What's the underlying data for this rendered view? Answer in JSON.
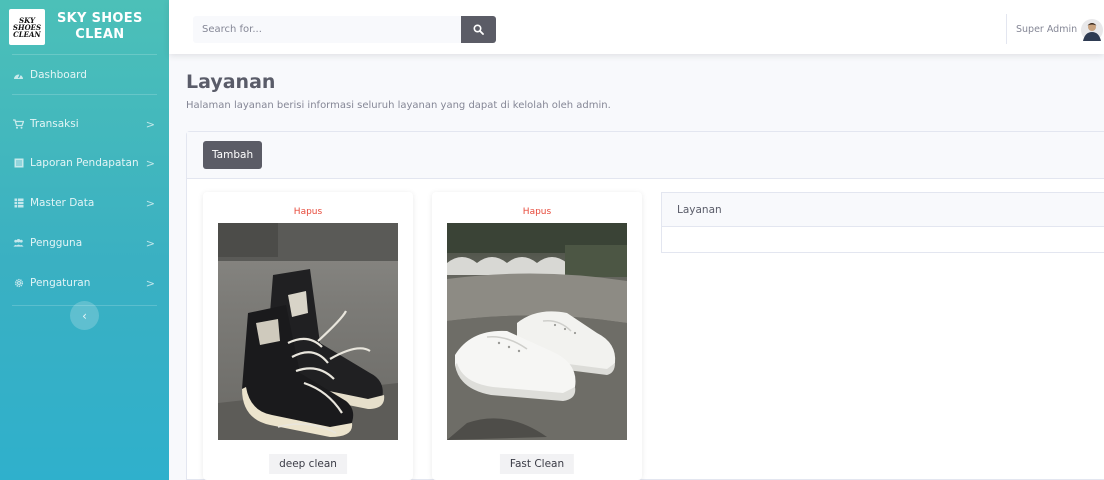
{
  "brand": {
    "logo_lines": [
      "SKY",
      "SHOES",
      "CLEAN"
    ],
    "title_line1": "SKY SHOES",
    "title_line2": "CLEAN"
  },
  "sidebar": {
    "items": [
      {
        "label": "Dashboard",
        "icon": "dashboard-icon",
        "has_chevron": false
      },
      {
        "label": "Transaksi",
        "icon": "cart-icon",
        "has_chevron": true
      },
      {
        "label": "Laporan Pendapatan",
        "icon": "report-icon",
        "has_chevron": true
      },
      {
        "label": "Master Data",
        "icon": "database-icon",
        "has_chevron": true
      },
      {
        "label": "Pengguna",
        "icon": "users-icon",
        "has_chevron": true
      },
      {
        "label": "Pengaturan",
        "icon": "gear-icon",
        "has_chevron": true
      }
    ],
    "chevron": ">",
    "toggle": "‹"
  },
  "topbar": {
    "search_placeholder": "Search for...",
    "user_name": "Super Admin"
  },
  "page": {
    "title": "Layanan",
    "description": "Halaman layanan berisi informasi seluruh layanan yang dapat di kelolah oleh admin."
  },
  "panel": {
    "add_label": "Tambah",
    "cards": [
      {
        "delete_label": "Hapus",
        "name": "deep clean"
      },
      {
        "delete_label": "Hapus",
        "name": "Fast Clean"
      }
    ],
    "table_header": "Layanan"
  },
  "colors": {
    "sidebar_top": "#4cc0b8",
    "sidebar_bottom": "#2fb0cc",
    "button": "#5b5c66",
    "danger": "#e74a3b"
  }
}
